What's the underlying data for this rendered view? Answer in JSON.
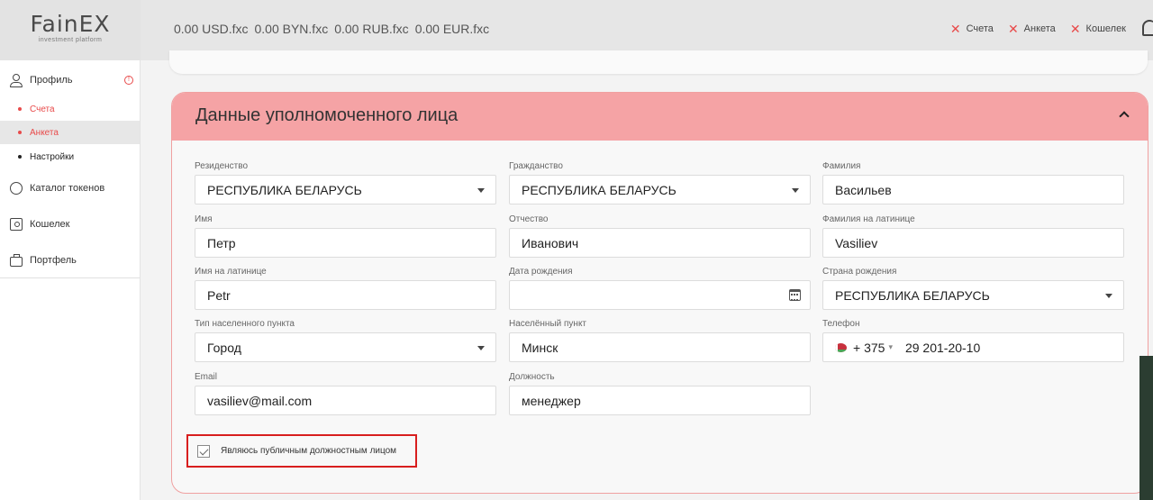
{
  "header": {
    "logo_name": "FainEX",
    "logo_sub": "investment platform",
    "balances": [
      {
        "amount": "0.00",
        "currency": "USD.fxc"
      },
      {
        "amount": "0.00",
        "currency": "BYN.fxc"
      },
      {
        "amount": "0.00",
        "currency": "RUB.fxc"
      },
      {
        "amount": "0.00",
        "currency": "EUR.fxc"
      }
    ],
    "links": [
      {
        "label": "Счета",
        "icon": "close-icon"
      },
      {
        "label": "Анкета",
        "icon": "close-icon"
      },
      {
        "label": "Кошелек",
        "icon": "close-icon"
      }
    ]
  },
  "sidebar": {
    "profile": "Профиль",
    "sub": [
      "Счета",
      "Анкета",
      "Настройки"
    ],
    "catalog": "Каталог токенов",
    "wallet": "Кошелек",
    "portfolio": "Портфель"
  },
  "section": {
    "title": "Данные уполномоченного лица"
  },
  "form": {
    "residence": {
      "label": "Резиденство",
      "value": "РЕСПУБЛИКА БЕЛАРУСЬ"
    },
    "citizenship": {
      "label": "Гражданство",
      "value": "РЕСПУБЛИКА БЕЛАРУСЬ"
    },
    "surname": {
      "label": "Фамилия",
      "value": "Васильев"
    },
    "name": {
      "label": "Имя",
      "value": "Петр"
    },
    "patronymic": {
      "label": "Отчество",
      "value": "Иванович"
    },
    "surname_latin": {
      "label": "Фамилия на латинице",
      "value": "Vasiliev"
    },
    "name_latin": {
      "label": "Имя на латинице",
      "value": "Petr"
    },
    "birth_date": {
      "label": "Дата рождения",
      "value": ""
    },
    "birth_country": {
      "label": "Страна рождения",
      "value": "РЕСПУБЛИКА БЕЛАРУСЬ"
    },
    "settlement_type": {
      "label": "Тип населенного пункта",
      "value": "Город"
    },
    "settlement": {
      "label": "Населённый пункт",
      "value": "Минск"
    },
    "phone": {
      "label": "Телефон",
      "code": "+ 375",
      "value": "29 201-20-10"
    },
    "email": {
      "label": "Email",
      "value": "vasiliev@mail.com"
    },
    "position": {
      "label": "Должность",
      "value": "менеджер"
    },
    "pep_checkbox": {
      "label": "Являюсь публичным должностным лицом",
      "checked": true
    }
  }
}
